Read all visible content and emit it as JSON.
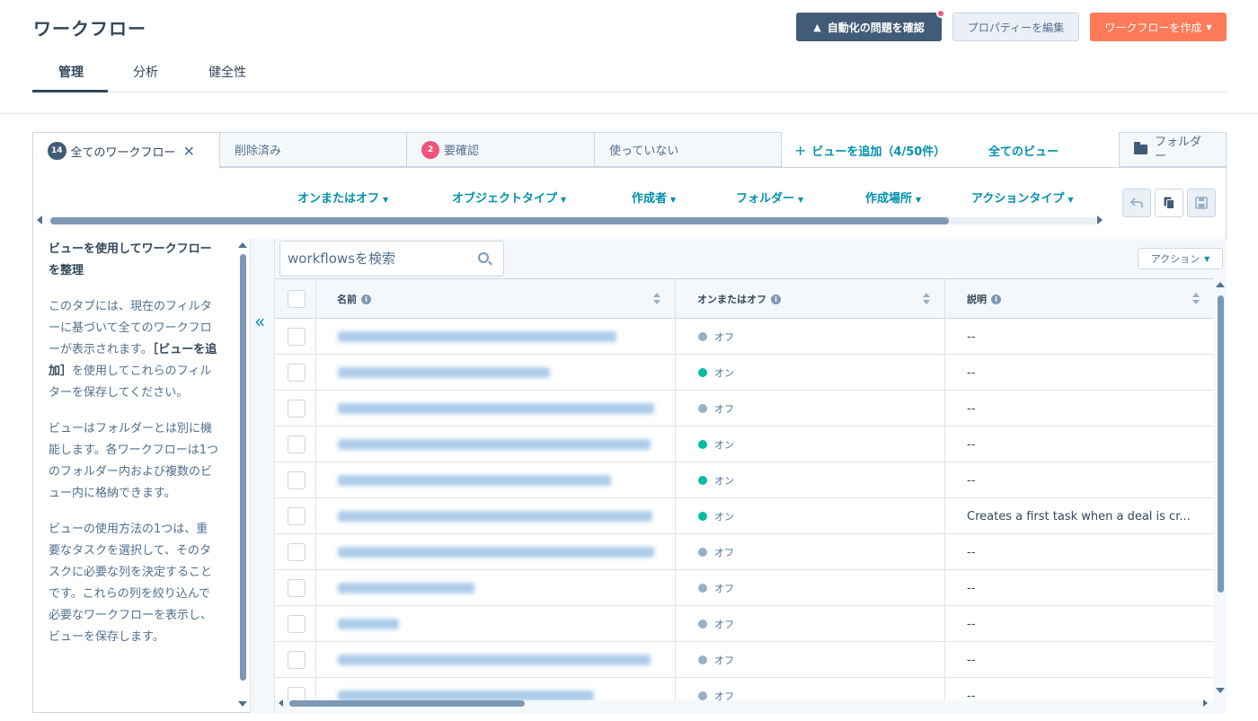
{
  "header": {
    "title": "ワークフロー",
    "buttons": {
      "review_issues": "自動化の問題を確認",
      "edit_properties": "プロパティーを編集",
      "create_workflow": "ワークフローを作成"
    }
  },
  "tabs": [
    "管理",
    "分析",
    "健全性"
  ],
  "views": {
    "tabs": [
      {
        "label": "全てのワークフロー",
        "badge": "14"
      },
      {
        "label": "削除済み"
      },
      {
        "label": "要確認",
        "badge": "2"
      },
      {
        "label": "使っていない"
      }
    ],
    "add_view": "ビューを追加（4/50件）",
    "all_views": "全てのビュー",
    "folder": "フォルダー"
  },
  "filters": [
    "オンまたはオフ",
    "オブジェクトタイプ",
    "作成者",
    "フォルダー",
    "作成場所",
    "アクションタイプ"
  ],
  "sidebar": {
    "title": "ビューを使用してワークフローを整理",
    "p1_a": "このタブには、現在のフィルターに基づいて全てのワークフローが表示されます。",
    "p1_b": "［ビューを追加］",
    "p1_c": "を使用してこれらのフィルターを保存してください。",
    "p2": "ビューはフォルダーとは別に機能します。各ワークフローは1つのフォルダー内および複数のビュー内に格納できます。",
    "p3": "ビューの使用方法の1つは、重要なタスクを選択して、そのタスクに必要な列を決定することです。これらの列を絞り込んで必要なワークフローを表示し、ビューを保存します。"
  },
  "search": {
    "placeholder": "workflowsを検索"
  },
  "actions_label": "アクション",
  "columns": [
    "名前",
    "オンまたはオフ",
    "説明"
  ],
  "colors": {
    "on": "#00bda5",
    "off": "#99afc4",
    "accent": "#0091ae",
    "primary": "#ff7a59",
    "dark": "#425b76",
    "alert": "#f2547d"
  },
  "rows": [
    {
      "name": "",
      "status": "オフ",
      "on": false,
      "description": "--"
    },
    {
      "name": "",
      "status": "オン",
      "on": true,
      "description": "--"
    },
    {
      "name": "",
      "status": "オフ",
      "on": false,
      "description": "--"
    },
    {
      "name": "",
      "status": "オン",
      "on": true,
      "description": "--"
    },
    {
      "name": "",
      "status": "オン",
      "on": true,
      "description": "--"
    },
    {
      "name": "",
      "status": "オン",
      "on": true,
      "description": "Creates a first task when a deal is cr..."
    },
    {
      "name": "",
      "status": "オフ",
      "on": false,
      "description": "--"
    },
    {
      "name": "",
      "status": "オフ",
      "on": false,
      "description": "--"
    },
    {
      "name": "",
      "status": "オフ",
      "on": false,
      "description": "--"
    },
    {
      "name": "",
      "status": "オフ",
      "on": false,
      "description": "--"
    },
    {
      "name": "",
      "status": "オフ",
      "on": false,
      "description": "--"
    }
  ]
}
